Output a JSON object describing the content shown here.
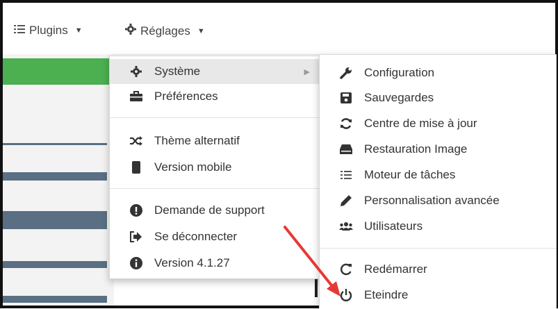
{
  "nav": {
    "plugins_label": "Plugins",
    "reglages_label": "Réglages"
  },
  "dropdown": {
    "items": [
      {
        "label": "Système"
      },
      {
        "label": "Préférences"
      },
      {
        "label": "Thème alternatif"
      },
      {
        "label": "Version mobile"
      },
      {
        "label": "Demande de support"
      },
      {
        "label": "Se déconnecter"
      },
      {
        "label": "Version 4.1.27"
      }
    ]
  },
  "submenu": {
    "items": [
      {
        "label": "Configuration"
      },
      {
        "label": "Sauvegardes"
      },
      {
        "label": "Centre de mise à jour"
      },
      {
        "label": "Restauration Image"
      },
      {
        "label": "Moteur de tâches"
      },
      {
        "label": "Personnalisation avancée"
      },
      {
        "label": "Utilisateurs"
      },
      {
        "label": "Redémarrer"
      },
      {
        "label": "Eteindre"
      }
    ]
  },
  "colors": {
    "green_bar": "#4caf50",
    "slate_band": "#5a6f83",
    "annotation_arrow": "#e53935"
  }
}
